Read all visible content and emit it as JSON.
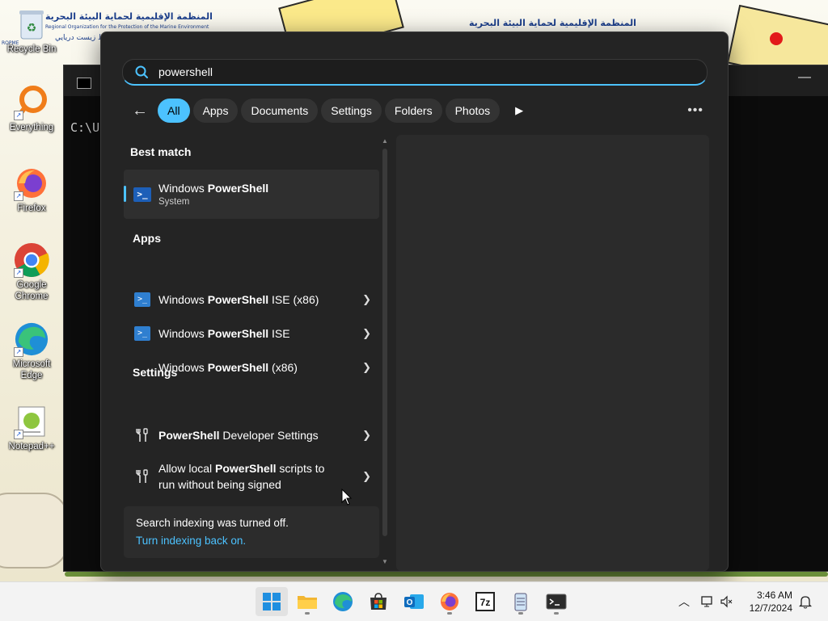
{
  "desktop": {
    "icons": [
      {
        "label": "Recycle Bin"
      },
      {
        "label": "Everything"
      },
      {
        "label": "Firefox"
      },
      {
        "label": "Google Chrome"
      },
      {
        "label": "Microsoft Edge"
      },
      {
        "label": "Notepad++"
      }
    ],
    "wallpaper": {
      "banner_arabic_1": "المنظمة الإقليمية لحماية البيئة البحرية",
      "banner_arabic_2": "المنظمة الإقليمية لحماية البيئة البحرية",
      "banner_english": "Regional Organization for the Protection of the Marine Environment",
      "banner_arabic_3": "يات محيط زيست دريايي",
      "ropme": "ROPME"
    }
  },
  "terminal": {
    "prompt": "C:\\Us"
  },
  "search": {
    "query": "powershell",
    "filters": [
      "All",
      "Apps",
      "Documents",
      "Settings",
      "Folders",
      "Photos"
    ],
    "active_filter": "All",
    "best_match_header": "Best match",
    "best_match": {
      "prefix": "Windows ",
      "bold": "PowerShell",
      "suffix": "",
      "subtitle": "System"
    },
    "apps_header": "Apps",
    "apps": [
      {
        "prefix": "Windows ",
        "bold": "PowerShell",
        "suffix": " ISE (x86)"
      },
      {
        "prefix": "Windows ",
        "bold": "PowerShell",
        "suffix": " ISE"
      },
      {
        "prefix": "Windows ",
        "bold": "PowerShell",
        "suffix": " (x86)"
      }
    ],
    "settings_header": "Settings",
    "settings": [
      {
        "prefix": "",
        "bold": "PowerShell",
        "suffix": " Developer Settings"
      },
      {
        "prefix": "Allow local ",
        "bold": "PowerShell",
        "suffix": " scripts to",
        "line2": "run without being signed"
      }
    ],
    "notice": {
      "text": "Search indexing was turned off.",
      "link": "Turn indexing back on."
    }
  },
  "taskbar": {
    "apps": [
      "start-icon",
      "file-explorer-icon",
      "edge-icon",
      "microsoft-store-icon",
      "outlook-icon",
      "firefox-icon",
      "7zip-icon",
      "notepad-icon",
      "terminal-icon"
    ],
    "time": "3:46 AM",
    "date": "12/7/2024",
    "accent": "#4cc2ff"
  }
}
